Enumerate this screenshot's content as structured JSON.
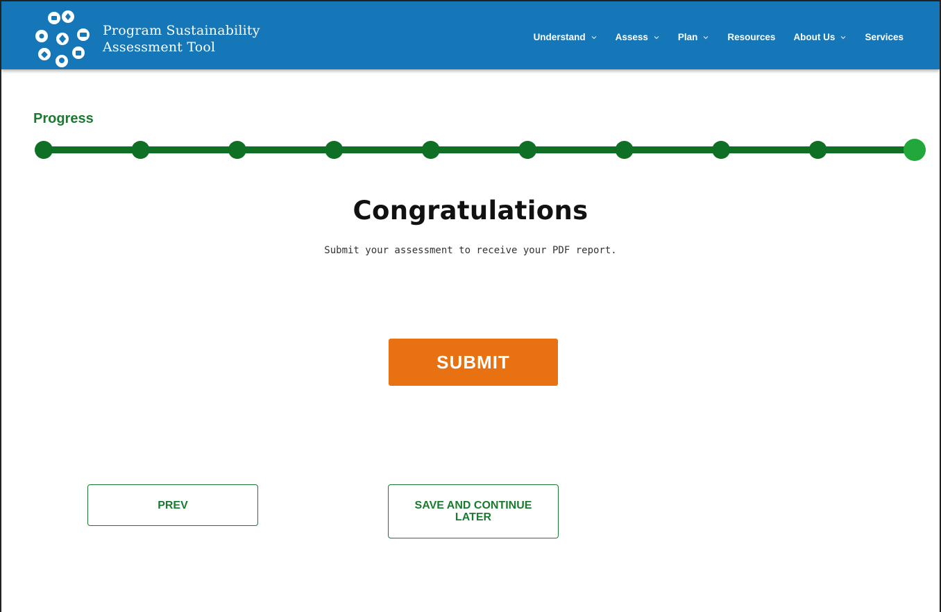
{
  "header": {
    "logo_line1": "Program Sustainability",
    "logo_line2": "Assessment Tool",
    "background_color": "#1577b7",
    "nav": [
      {
        "label": "Understand",
        "has_dropdown": true
      },
      {
        "label": "Assess",
        "has_dropdown": true
      },
      {
        "label": "Plan",
        "has_dropdown": true
      },
      {
        "label": "Resources",
        "has_dropdown": false
      },
      {
        "label": "About Us",
        "has_dropdown": true
      },
      {
        "label": "Services",
        "has_dropdown": false
      }
    ]
  },
  "progress": {
    "label": "Progress",
    "total_steps": 10,
    "current_step": 10,
    "track_color": "#0f6f25",
    "current_color": "#22a83a"
  },
  "main": {
    "heading": "Congratulations",
    "subtext": "Submit your assessment to receive your PDF report."
  },
  "buttons": {
    "submit_label": "SUBMIT",
    "submit_color": "#e87112",
    "prev_label": "PREV",
    "save_label_line1": "SAVE AND CONTINUE",
    "save_label_line2": "LATER"
  },
  "icons": {
    "logo": "sustainability-domains-icon-cluster",
    "nav_dropdown": "chevron-down-icon"
  }
}
